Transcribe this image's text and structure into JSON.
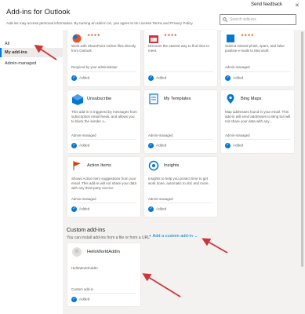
{
  "dialog": {
    "title": "Add-ins for Outlook",
    "send_feedback": "Send feedback",
    "notice": "Add-ins may access personal information. By turning an add-in on, you agree to its License Terms and Privacy Policy.",
    "search_placeholder": "Search add-ins"
  },
  "nav": {
    "items": [
      {
        "label": "All"
      },
      {
        "label": "My add-ins"
      },
      {
        "label": "Admin-managed"
      }
    ]
  },
  "top_cards": [
    {
      "desc": "Work with SharePoint Online files directly from Outlook",
      "req": "Required by your administrator",
      "added": "Added",
      "icon": "sharepoint-icon"
    },
    {
      "desc": "Discover the easiest way to find time to meet.",
      "req": "",
      "added": "Added",
      "icon": "calendar-icon"
    },
    {
      "desc": "Submit missed phish, spam, and false positive e-mails to Microsoft.",
      "req": "Admin-managed",
      "added": "Added",
      "icon": "report-icon"
    }
  ],
  "cards_row2": [
    {
      "name": "Unsubscribe",
      "desc": "This add-in is triggered by messages from subscription email feeds, and allows you to block the sender o...",
      "req": "Admin-managed",
      "added": "Added",
      "icon": "unsubscribe-icon"
    },
    {
      "name": "My Templates",
      "desc": "",
      "req": "Admin-managed",
      "added": "Added",
      "icon": "templates-icon"
    },
    {
      "name": "Bing Maps",
      "desc": "Map addresses found in your email. This add-in will send addresses to Bing but will not share your data with any...",
      "req": "Admin-managed",
      "added": "Added",
      "icon": "bing-maps-icon"
    }
  ],
  "cards_row3": [
    {
      "name": "Action Items",
      "desc": "Shows Action Item suggestions from your email. This add-in will not share your data with any third-party service.",
      "req": "Admin-managed",
      "added": "Added",
      "icon": "action-items-icon"
    },
    {
      "name": "Insights",
      "desc": "Insights to help you protect time to get work done, automatic to doc and more.",
      "req": "Admin-managed",
      "added": "Added",
      "icon": "insights-icon"
    }
  ],
  "custom": {
    "title": "Custom add-ins",
    "desc": "You can install add-ins from a file or from a URL",
    "add_label": "+ Add a custom add-in ⌄",
    "card": {
      "name": "HelloWorldAddIn",
      "sub": "HelloWorldAddIn",
      "req": "Custom add-in",
      "added": "Added"
    }
  },
  "colors": {
    "accent": "#0078d4",
    "annotation": "#d13438"
  }
}
